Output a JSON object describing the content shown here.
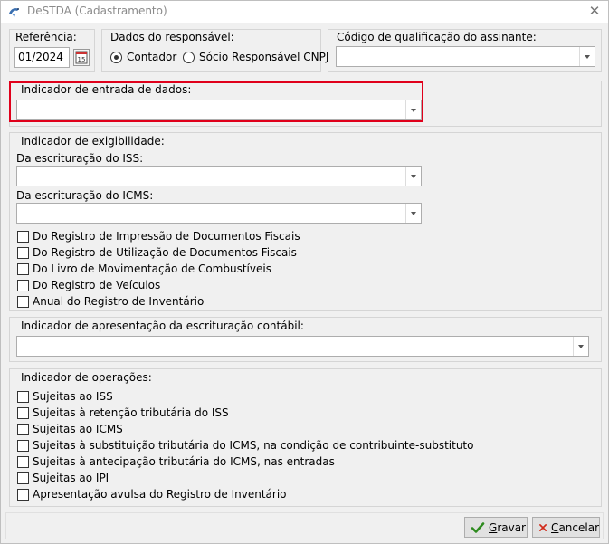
{
  "window": {
    "title": "DeSTDA (Cadastramento)",
    "close_glyph": "✕",
    "icon": "app-dove-icon"
  },
  "referencia": {
    "label": "Referência:",
    "value": "01/2024",
    "calendar_icon": "calendar-icon",
    "calendar_glyph": "15"
  },
  "responsavel": {
    "label": "Dados do responsável:",
    "options": [
      {
        "label": "Contador",
        "selected": true
      },
      {
        "label": "Sócio Responsável CNPJ",
        "selected": false
      }
    ]
  },
  "qualificacao": {
    "label": "Código de qualificação do assinante:",
    "value": ""
  },
  "entrada": {
    "label": "Indicador de entrada de dados:",
    "value": ""
  },
  "exigibilidade": {
    "label": "Indicador de exigibilidade:",
    "iss_label": "Da escrituração do ISS:",
    "iss_value": "",
    "icms_label": "Da escrituração do ICMS:",
    "icms_value": "",
    "checks": [
      {
        "label": "Do Registro de Impressão de Documentos Fiscais",
        "checked": false
      },
      {
        "label": "Do Registro de Utilização de Documentos Fiscais",
        "checked": false
      },
      {
        "label": "Do Livro de Movimentação de Combustíveis",
        "checked": false
      },
      {
        "label": "Do Registro de Veículos",
        "checked": false
      },
      {
        "label": "Anual do Registro de Inventário",
        "checked": false
      }
    ]
  },
  "contabil": {
    "label": "Indicador de apresentação da escrituração contábil:",
    "value": ""
  },
  "operacoes": {
    "label": "Indicador de operações:",
    "checks": [
      {
        "label": "Sujeitas ao ISS",
        "checked": false
      },
      {
        "label": "Sujeitas à retenção tributária do ISS",
        "checked": false
      },
      {
        "label": "Sujeitas ao ICMS",
        "checked": false
      },
      {
        "label": "Sujeitas à substituição tributária do ICMS, na condição de contribuinte-substituto",
        "checked": false
      },
      {
        "label": "Sujeitas à antecipação tributária do ICMS, nas entradas",
        "checked": false
      },
      {
        "label": "Sujeitas ao IPI",
        "checked": false
      },
      {
        "label": "Apresentação avulsa do Registro de Inventário",
        "checked": false
      }
    ]
  },
  "buttons": {
    "gravar_first": "G",
    "gravar_rest": "ravar",
    "cancelar_first": "C",
    "cancelar_rest": "ancelar",
    "gravar_icon": "checkmark-icon",
    "cancelar_icon": "x-icon",
    "colors": {
      "check": "#2e8b1f",
      "x": "#d12a1a",
      "highlight": "#e0001b"
    }
  }
}
